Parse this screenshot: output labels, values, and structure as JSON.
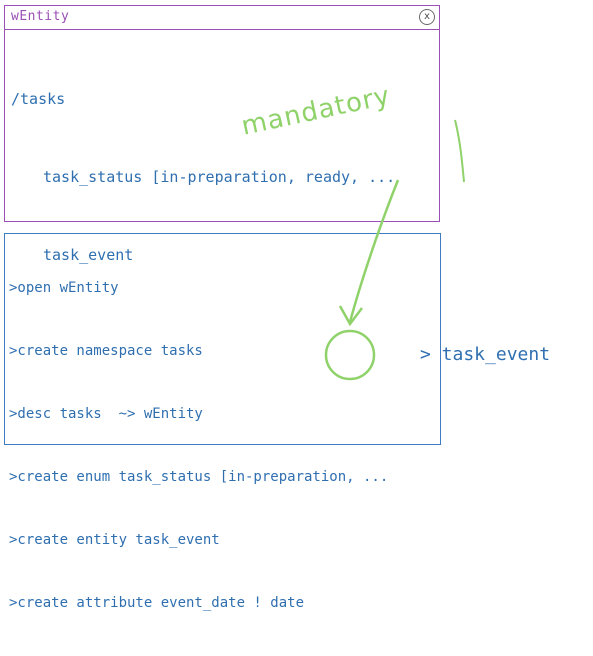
{
  "entity_panel": {
    "title": "wEntity",
    "close_symbol": "x",
    "namespace_line": "/tasks",
    "fields": [
      "task_status [in-preparation, ready, ...",
      "task_event"
    ]
  },
  "console": {
    "lines": [
      ">open wEntity",
      ">create namespace tasks",
      ">desc tasks  ~> wEntity",
      ">create enum task_status [in-preparation, ...",
      ">create entity task_event",
      ">create attribute event_date ! date"
    ],
    "tail": "> task_event"
  },
  "annotation": {
    "label": "mandatory",
    "color": "#8fd26a"
  },
  "colors": {
    "entity_border": "#9b4fb4",
    "console_border": "#3d7cc0",
    "text": "#2f6fb0"
  }
}
